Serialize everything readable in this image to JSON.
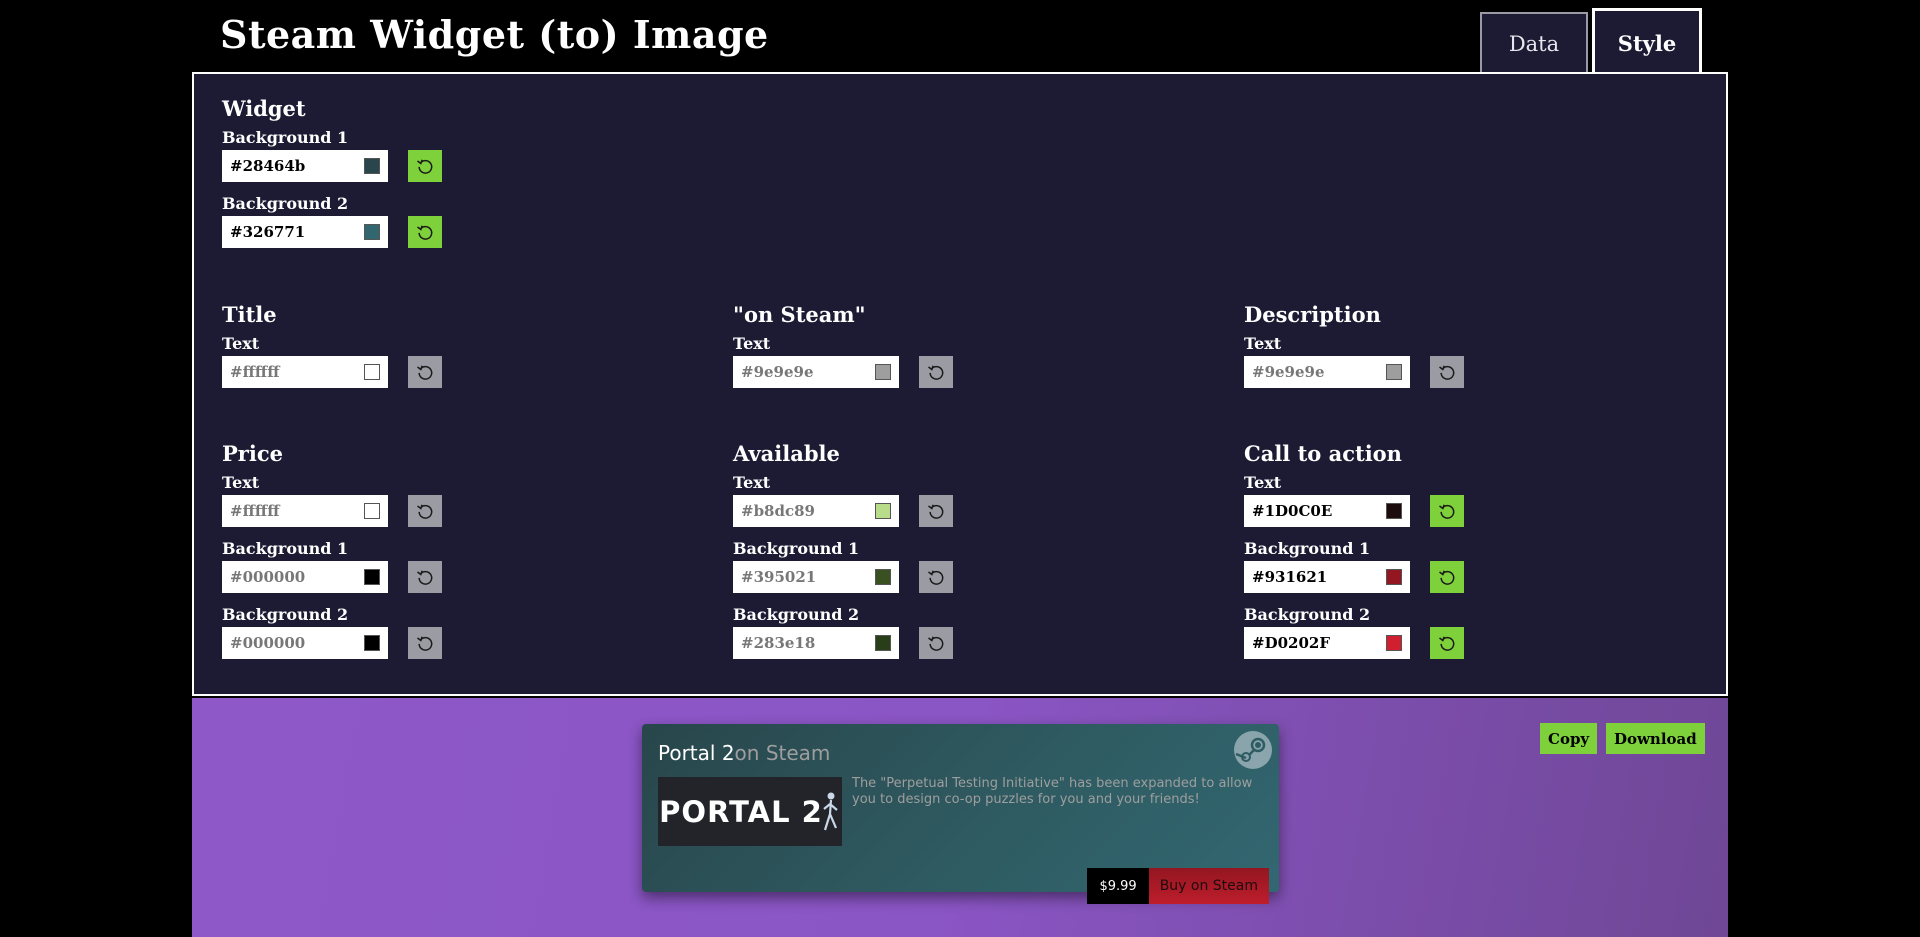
{
  "header": {
    "title": "Steam Widget (to) Image"
  },
  "tabs": [
    {
      "label": "Data"
    },
    {
      "label": "Style"
    }
  ],
  "sections": {
    "widget": {
      "heading": "Widget",
      "fields": [
        {
          "label": "Background 1",
          "value": "#28464b",
          "color": "#28464b"
        },
        {
          "label": "Background 2",
          "value": "#326771",
          "color": "#326771"
        }
      ]
    },
    "title": {
      "heading": "Title",
      "fields": [
        {
          "label": "Text",
          "value": "#ffffff",
          "color": "#ffffff"
        }
      ]
    },
    "on_steam": {
      "heading": "\"on Steam\"",
      "fields": [
        {
          "label": "Text",
          "value": "#9e9e9e",
          "color": "#9e9e9e"
        }
      ]
    },
    "description": {
      "heading": "Description",
      "fields": [
        {
          "label": "Text",
          "value": "#9e9e9e",
          "color": "#9e9e9e"
        }
      ]
    },
    "price": {
      "heading": "Price",
      "fields": [
        {
          "label": "Text",
          "value": "#ffffff",
          "color": "#ffffff"
        },
        {
          "label": "Background 1",
          "value": "#000000",
          "color": "#000000"
        },
        {
          "label": "Background 2",
          "value": "#000000",
          "color": "#000000"
        }
      ]
    },
    "available": {
      "heading": "Available",
      "fields": [
        {
          "label": "Text",
          "value": "#b8dc89",
          "color": "#b8dc89"
        },
        {
          "label": "Background 1",
          "value": "#395021",
          "color": "#395021"
        },
        {
          "label": "Background 2",
          "value": "#283e18",
          "color": "#283e18"
        }
      ]
    },
    "call_to_action": {
      "heading": "Call to action",
      "fields": [
        {
          "label": "Text",
          "value": "#1D0C0E",
          "color": "#1D0C0E"
        },
        {
          "label": "Background 1",
          "value": "#931621",
          "color": "#931621"
        },
        {
          "label": "Background 2",
          "value": "#D0202F",
          "color": "#D0202F"
        }
      ]
    }
  },
  "preview": {
    "copy_label": "Copy",
    "download_label": "Download",
    "widget": {
      "game_title": "Portal 2",
      "on_steam": "on Steam",
      "capsule_text": "PORTAL 2",
      "description": "The \"Perpetual Testing Initiative\" has been expanded to allow you to design co-op puzzles for you and your friends!",
      "price": "$9.99",
      "buy_label": "Buy on Steam"
    }
  },
  "colors": {
    "reset_active": "#7fd13b",
    "reset_inactive": "#9b9ba4",
    "panel_bg": "#1c1b33"
  }
}
